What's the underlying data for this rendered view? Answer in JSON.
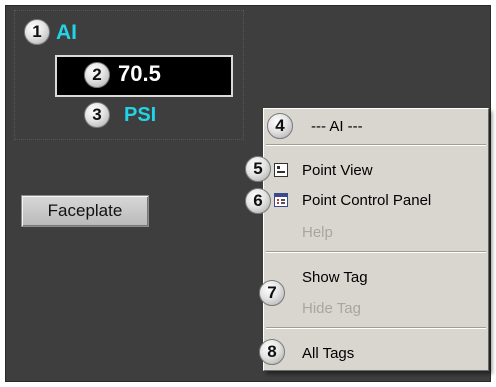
{
  "point": {
    "tag": "AI",
    "value": "70.5",
    "units": "PSI"
  },
  "faceplate_button": {
    "label": "Faceplate"
  },
  "menu": {
    "header": "--- AI ---",
    "items": [
      {
        "label": "Point View",
        "icon": "point-view-icon",
        "enabled": true
      },
      {
        "label": "Point Control Panel",
        "icon": "control-panel-icon",
        "enabled": true
      },
      {
        "label": "Help",
        "enabled": false
      },
      {
        "label": "Show Tag",
        "enabled": true
      },
      {
        "label": "Hide Tag",
        "enabled": false
      },
      {
        "label": "All Tags",
        "enabled": true
      }
    ]
  },
  "callouts": [
    "1",
    "2",
    "3",
    "4",
    "5",
    "6",
    "7",
    "8"
  ],
  "colors": {
    "panel_background": "#3e3e3e",
    "tag_text": "#22d3e6",
    "menu_background": "#d9d6cf"
  }
}
